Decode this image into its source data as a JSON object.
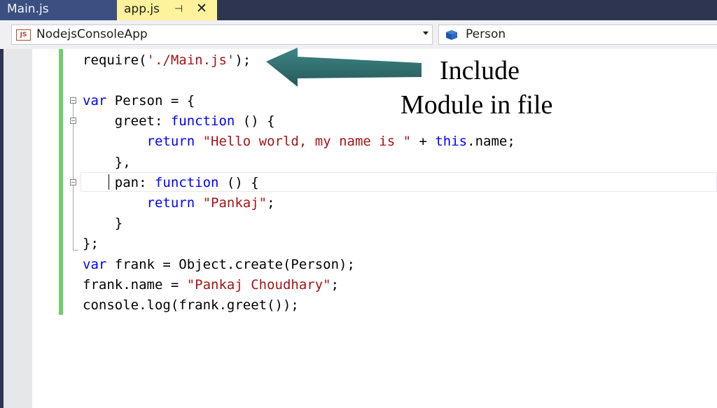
{
  "tabs": [
    {
      "label": "Main.js",
      "active": false
    },
    {
      "label": "app.js",
      "active": true
    }
  ],
  "navigation_bar": {
    "project_badge": "JS",
    "project": "NodejsConsoleApp",
    "member": "Person"
  },
  "code": {
    "line_1": {
      "plain_1": "require(",
      "string_1": "'./Main.js'",
      "plain_2": ");"
    },
    "line_3": {
      "keyword_1": "var",
      "plain_1": " Person = {"
    },
    "line_4": {
      "plain_1": "    greet: ",
      "keyword_1": "function",
      "plain_2": " () {"
    },
    "line_5": {
      "plain_0": "        ",
      "keyword_1": "return",
      "plain_1": " ",
      "string_1": "\"Hello world, my name is \"",
      "plain_2": " + ",
      "keyword_2": "this",
      "plain_3": ".name;"
    },
    "line_6": {
      "plain_1": "    },"
    },
    "line_7": {
      "plain_1": "    pan: ",
      "keyword_1": "function",
      "plain_2": " () {"
    },
    "line_8": {
      "plain_0": "        ",
      "keyword_1": "return",
      "plain_1": " ",
      "string_1": "\"Pankaj\"",
      "plain_2": ";"
    },
    "line_9": {
      "plain_1": "    }"
    },
    "line_10": {
      "plain_1": "};"
    },
    "line_11": {
      "keyword_1": "var",
      "plain_1": " frank = Object.create(Person);"
    },
    "line_12": {
      "plain_1": "frank.name = ",
      "string_1": "\"Pankaj Choudhary\"",
      "plain_2": ";"
    },
    "line_13": {
      "plain_1": "console.log(frank.greet());"
    }
  },
  "annotation": {
    "line_1": "Include",
    "line_2": "Module in file"
  },
  "colors": {
    "keyword": "#0000ff",
    "string": "#a31515",
    "arrow": "#2f6b6b",
    "change_bar": "#6cd06c",
    "active_tab": "#fff29d"
  }
}
